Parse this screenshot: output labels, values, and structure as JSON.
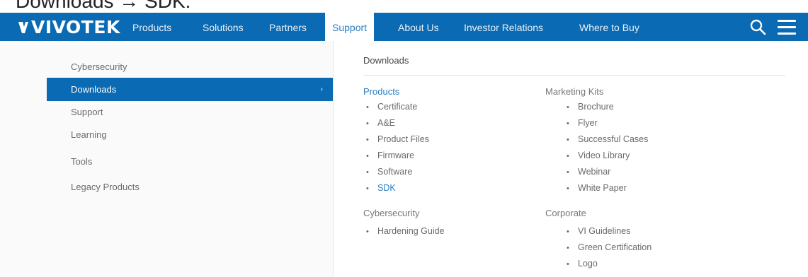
{
  "caption": "Downloads → SDK.",
  "navbar": {
    "logo": "VIVOTEK",
    "items": [
      {
        "label": "Products"
      },
      {
        "label": "Solutions"
      },
      {
        "label": "Partners"
      },
      {
        "label": "Support"
      },
      {
        "label": "About Us"
      },
      {
        "label": "Investor Relations"
      },
      {
        "label": "Where to Buy"
      }
    ],
    "active": "Support",
    "icons": [
      "search-icon",
      "hamburger-menu-icon"
    ]
  },
  "sidebar": {
    "items": [
      {
        "label": "Cybersecurity"
      },
      {
        "label": "Downloads"
      },
      {
        "label": "Support"
      },
      {
        "label": "Learning"
      },
      {
        "label": "Tools"
      },
      {
        "label": "Legacy Products"
      }
    ],
    "active": "Downloads",
    "active_arrow": "›"
  },
  "panel": {
    "title": "Downloads",
    "products": {
      "heading": "Products",
      "items": [
        "Certificate",
        "A&E",
        "Product Files",
        "Firmware",
        "Software",
        "SDK"
      ]
    },
    "cybersecurity": {
      "heading": "Cybersecurity",
      "items": [
        "Hardening Guide"
      ]
    },
    "marketing_kits": {
      "heading": "Marketing Kits",
      "items": [
        "Brochure",
        "Flyer",
        "Successful Cases",
        "Video Library",
        "Webinar",
        "White Paper"
      ]
    },
    "corporate": {
      "heading": "Corporate",
      "items": [
        "VI Guidelines",
        "Green Certification",
        "Logo"
      ]
    },
    "bullet": "•",
    "highlight_color": "#2a7fc4"
  },
  "colors": {
    "brand_blue": "#0a6ab3",
    "link_blue": "#2a7fc4"
  }
}
